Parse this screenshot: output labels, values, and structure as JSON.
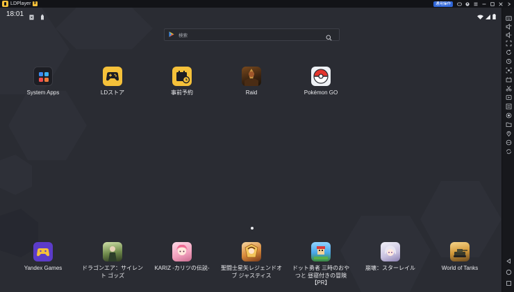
{
  "titlebar": {
    "app_title": "LDPlayer",
    "version_badge": "9",
    "mode_button": "通用操作"
  },
  "statusbar": {
    "time": "18:01"
  },
  "search": {
    "placeholder": "検索"
  },
  "home_apps": [
    {
      "label": "System Apps",
      "icon": "system-apps-folder-icon"
    },
    {
      "label": "LDストア",
      "icon": "gamepad-store-icon"
    },
    {
      "label": "事前予約",
      "icon": "pre-register-calendar-icon"
    },
    {
      "label": "Raid",
      "icon": "raid-game-icon"
    },
    {
      "label": "Pokémon GO",
      "icon": "pokeball-icon"
    }
  ],
  "dock_apps": [
    {
      "label": "Yandex Games",
      "icon": "yandex-games-icon"
    },
    {
      "label": "ドラゴンエア：サイレント ゴッズ",
      "icon": "dragon-air-game-icon"
    },
    {
      "label": "KARIZ -カリツの伝説-",
      "icon": "kariz-game-icon"
    },
    {
      "label": "聖闘士星矢レジェンドオブ ジャスティス",
      "icon": "saint-seiya-game-icon"
    },
    {
      "label": "ドット勇者 三時のおやつと 昼寝付きの冒険【PR】",
      "icon": "dot-hero-game-icon"
    },
    {
      "label": "崩壊：スターレイル",
      "icon": "star-rail-game-icon"
    },
    {
      "label": "World of Tanks",
      "icon": "world-of-tanks-icon"
    }
  ],
  "colors": {
    "screen_bg": "#2a2c33",
    "accent_yellow": "#f5c13a",
    "mode_button_blue": "#2f66d8"
  }
}
